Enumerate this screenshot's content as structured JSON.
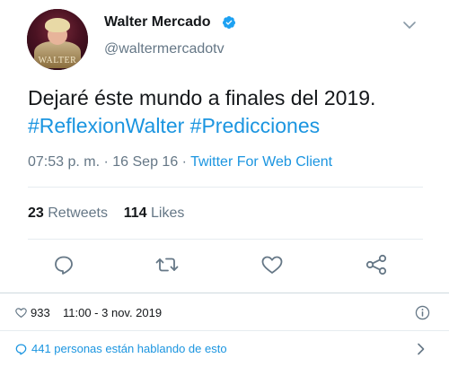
{
  "user": {
    "name": "Walter Mercado",
    "handle": "@waltermercadotv",
    "avatar_logo": "WALTER",
    "verified": true
  },
  "tweet": {
    "text": "Dejaré éste mundo a finales del 2019.",
    "hashtags": [
      "#ReflexionWalter",
      "#Predicciones"
    ],
    "time": "07:53 p. m.",
    "sep1": " · ",
    "date": "16 Sep 16",
    "sep2": " · ",
    "client": "Twitter For Web Client"
  },
  "stats": {
    "retweets_count": "23",
    "retweets_label": "Retweets",
    "likes_count": "114",
    "likes_label": "Likes"
  },
  "actions": [
    "reply-icon",
    "retweet-icon",
    "like-icon",
    "share-icon"
  ],
  "embed_footer": {
    "likes": "933",
    "timestamp": "11:00 - 3 nov. 2019",
    "talking": "441 personas están hablando de esto"
  },
  "colors": {
    "accent": "#1b95e0",
    "text": "#14171a",
    "muted": "#657786",
    "divider": "#e6ecf0"
  }
}
